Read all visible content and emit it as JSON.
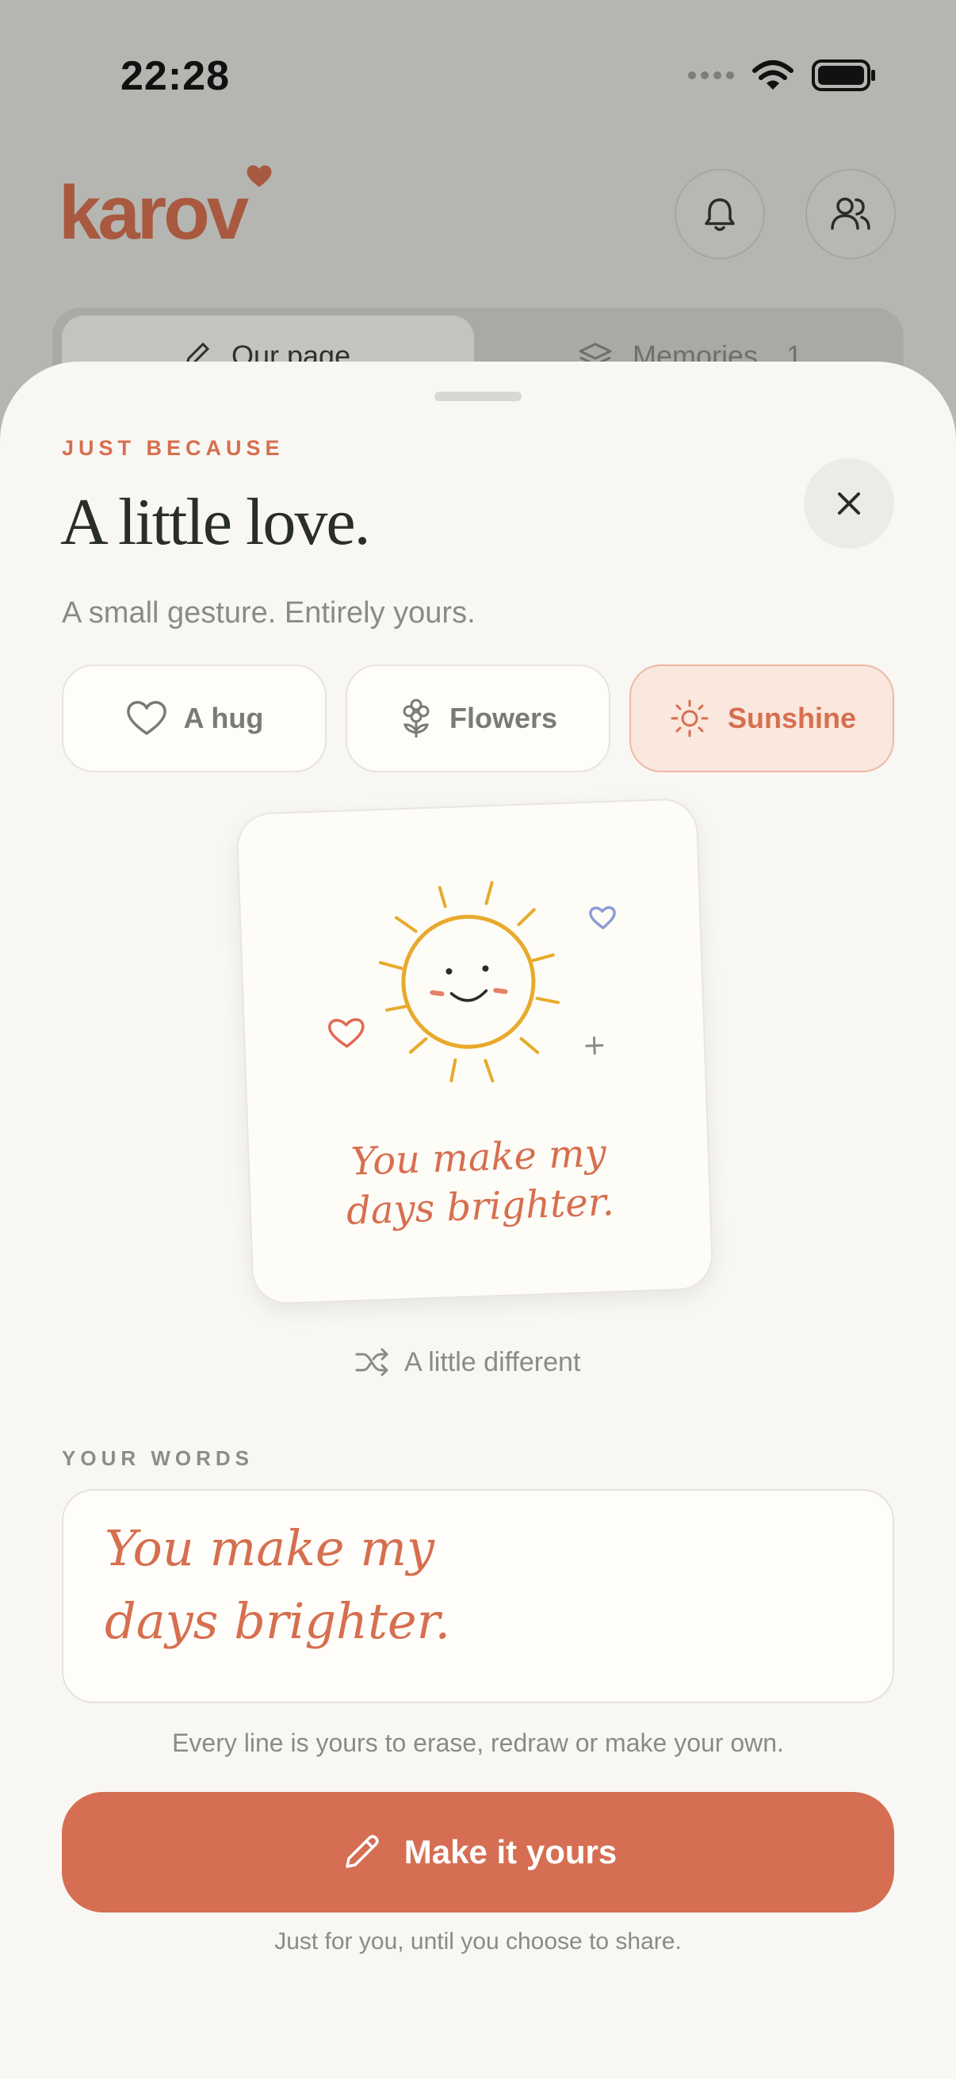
{
  "status_bar": {
    "time": "22:28"
  },
  "app": {
    "brand": "karov"
  },
  "header": {
    "icons": [
      "bell-icon",
      "people-icon"
    ]
  },
  "tabs": [
    {
      "label": "Our page",
      "icon": "pencil-icon",
      "active": true
    },
    {
      "label": "Memories",
      "icon": "stack-icon",
      "count": "1",
      "active": false
    }
  ],
  "sheet": {
    "eyebrow": "JUST BECAUSE",
    "title": "A little love.",
    "subtitle": "A small gesture. Entirely yours.",
    "options": [
      {
        "label": "A hug",
        "icon": "heart-icon",
        "selected": false
      },
      {
        "label": "Flowers",
        "icon": "flower-icon",
        "selected": false
      },
      {
        "label": "Sunshine",
        "icon": "sun-icon",
        "selected": true
      }
    ],
    "card": {
      "line1": "You make my",
      "line2": "days brighter.",
      "illustration": "smiling-sun"
    },
    "shuffle_label": "A little different",
    "words_label": "YOUR WORDS",
    "words": {
      "line1": "You make my",
      "line2": "days brighter."
    },
    "hint": "Every line is yours to erase, redraw or make your own.",
    "cta_label": "Make it yours",
    "footnote": "Just for you, until you choose to share."
  },
  "colors": {
    "accent": "#d56e52",
    "sun": "#e8aa2c",
    "background": "#f8f7f3",
    "selected_chip": "#fae7de"
  }
}
